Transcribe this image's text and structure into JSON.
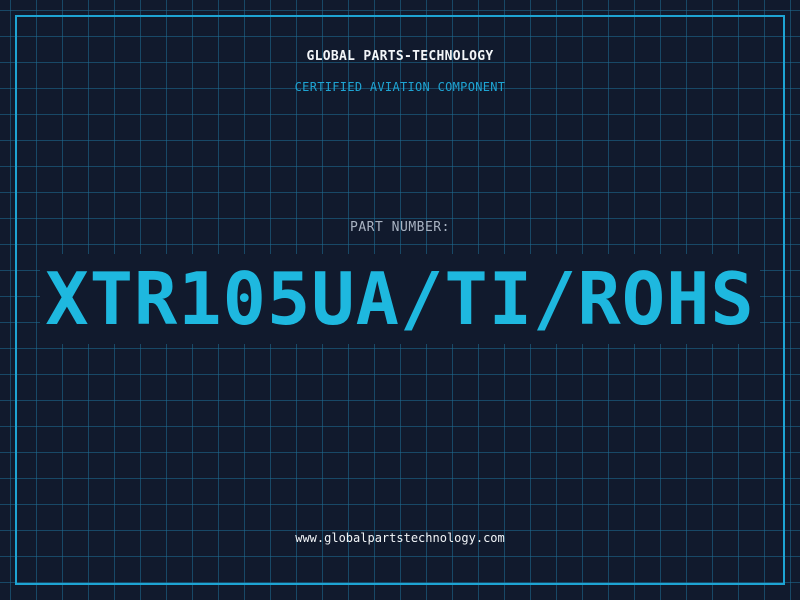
{
  "header": {
    "company": "GLOBAL PARTS-TECHNOLOGY",
    "subtitle": "CERTIFIED AVIATION COMPONENT"
  },
  "part": {
    "label": "PART NUMBER:",
    "number": "XTR105UA/TI/ROHS"
  },
  "footer": {
    "url": "www.globalpartstechnology.com"
  },
  "colors": {
    "background": "#111a2d",
    "grid": "#1e6e96",
    "accent": "#1ea4d3",
    "part_number": "#1eb8df",
    "text": "#f2f5f8",
    "muted": "#a9b3c2"
  }
}
